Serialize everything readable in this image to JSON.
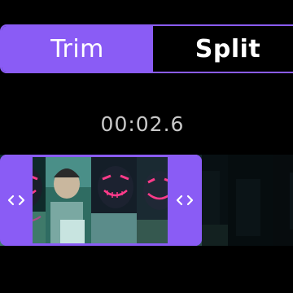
{
  "mode_tabs": {
    "trim_label": "Trim",
    "split_label": "Split",
    "active": "Trim"
  },
  "playhead": {
    "timestamp": "00:02.6"
  },
  "timeline": {
    "left_handle_icon": "chevron-left-right-icon",
    "right_handle_icon": "chevron-left-right-icon"
  },
  "colors": {
    "accent": "#8a5cf5",
    "background": "#000000",
    "timestamp_text": "#c8c8c8"
  }
}
